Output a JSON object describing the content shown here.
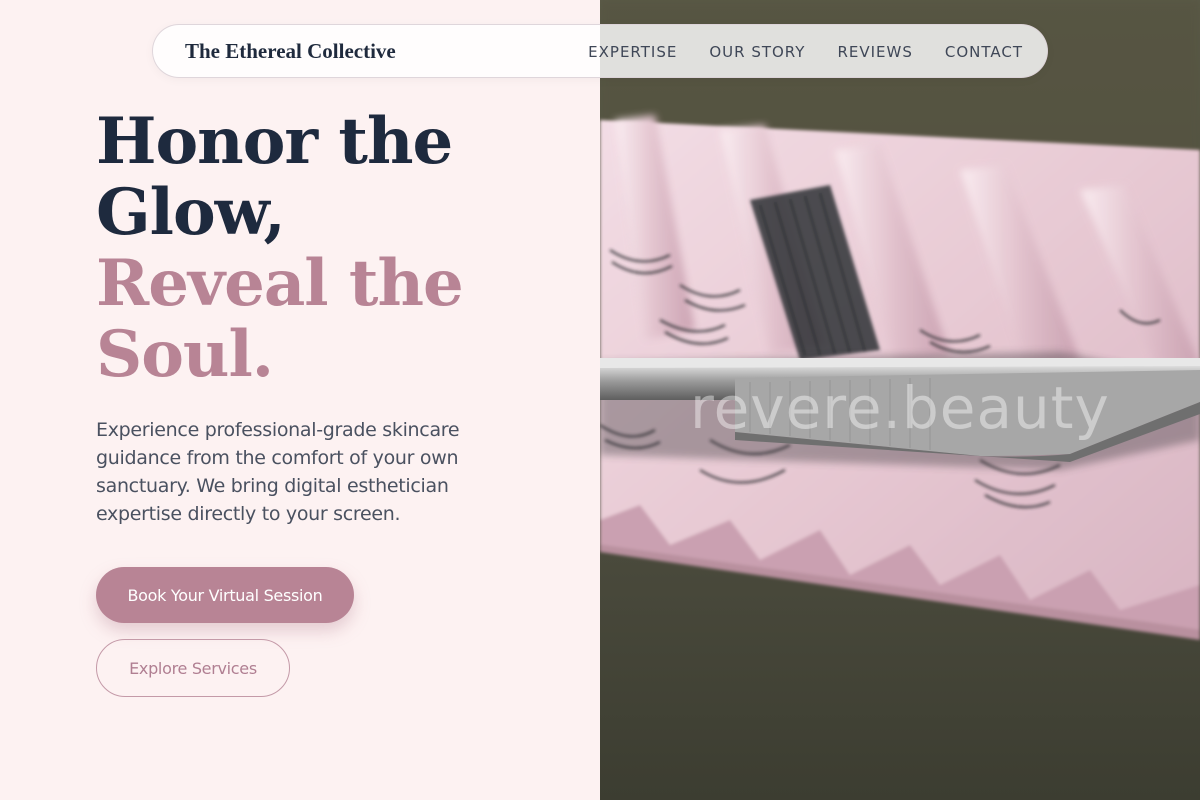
{
  "brand": {
    "name": "The Ethereal Collective"
  },
  "nav": {
    "items": [
      "EXPERTISE",
      "OUR STORY",
      "REVIEWS",
      "CONTACT"
    ]
  },
  "hero": {
    "title_line1": "Honor the",
    "title_line2": "Glow,",
    "title_line3": "Reveal the",
    "title_line4": "Soul.",
    "description": "Experience professional-grade skincare guidance from the comfort of your own sanctuary. We bring digital esthetician expertise directly to your screen.",
    "primary_cta": "Book Your Virtual Session",
    "secondary_cta": "Explore Services"
  },
  "image": {
    "alt": "Eyelash extensions on a pink tray being picked with tweezers",
    "watermark": "revere.beauty"
  },
  "colors": {
    "background": "#fdf2f2",
    "navy": "#1e2a3e",
    "rose": "#b88495",
    "body_text": "#4a5160"
  }
}
